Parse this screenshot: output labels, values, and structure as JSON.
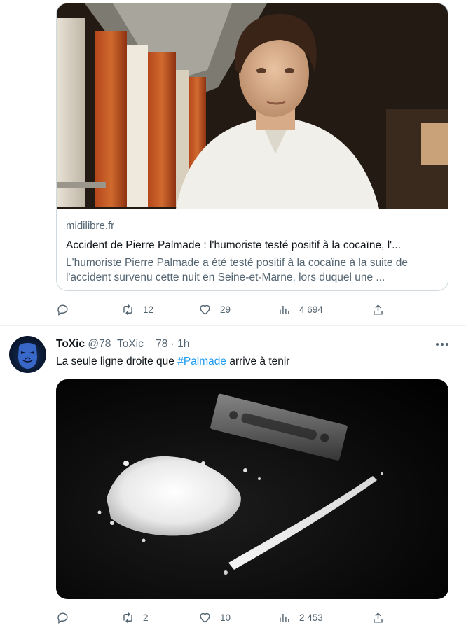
{
  "tweet1": {
    "card": {
      "domain": "midilibre.fr",
      "title": "Accident de Pierre Palmade : l'humoriste testé positif à la cocaïne, l'...",
      "description_line1": "L'humoriste Pierre Palmade a été testé positif à la cocaïne à la suite de",
      "description_line2": "l'accident survenu cette nuit en Seine-et-Marne, lors duquel une ..."
    },
    "actions": {
      "replies": "",
      "retweets": "12",
      "likes": "29",
      "views": "4 694"
    }
  },
  "tweet2": {
    "author_name": "ToXic",
    "author_handle": "@78_ToXic__78",
    "separator": "·",
    "time": "1h",
    "text_before": "La seule ligne droite que ",
    "hashtag": "#Palmade",
    "text_after": " arrive à tenir",
    "actions": {
      "replies": "",
      "retweets": "2",
      "likes": "10",
      "views": "2 453"
    }
  },
  "icons": {
    "reply": "reply-icon",
    "retweet": "retweet-icon",
    "like": "heart-icon",
    "views": "views-icon",
    "share": "share-icon",
    "more": "more-icon"
  },
  "colors": {
    "link": "#1d9bf0",
    "secondary_text": "#536471",
    "border": "#cfd9de"
  }
}
